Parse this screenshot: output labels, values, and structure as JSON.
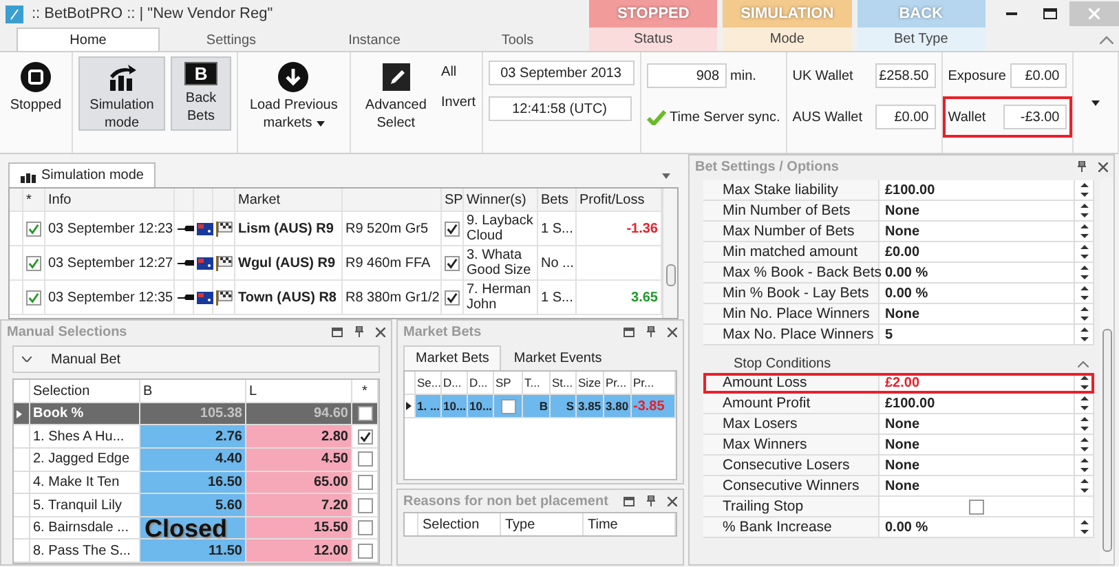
{
  "window": {
    "title": ":: BetBotPRO :: | \"New Vendor Reg\""
  },
  "ribbon_tabs": [
    {
      "label": "Home",
      "selected": true
    },
    {
      "label": "Settings",
      "selected": false
    },
    {
      "label": "Instance",
      "selected": false
    },
    {
      "label": "Tools",
      "selected": false
    }
  ],
  "context_tabs": [
    {
      "badge": "STOPPED",
      "label": "Status",
      "color": "#f29b9b"
    },
    {
      "badge": "SIMULATION",
      "label": "Mode",
      "color": "#f3c98c"
    },
    {
      "badge": "BACK",
      "label": "Bet Type",
      "color": "#b5d6ee"
    }
  ],
  "ribbon": {
    "buttons": [
      {
        "kind": "stop",
        "label": "Stopped",
        "selected": false,
        "dropdown": false
      },
      {
        "kind": "chart",
        "label": "Simulation mode",
        "selected": true,
        "dropdown": false
      },
      {
        "kind": "letter",
        "icon_text": "B",
        "label": "Back Bets",
        "selected": true,
        "dropdown": false
      },
      {
        "kind": "download",
        "label": "Load Previous markets",
        "selected": false,
        "dropdown": true
      },
      {
        "kind": "edit",
        "label": "Advanced Select",
        "selected": false,
        "dropdown": false
      }
    ],
    "select_links": [
      "All",
      "Invert"
    ],
    "date": "03 September 2013",
    "time": "12:41:58 (UTC)",
    "minutes": "908",
    "minutes_unit": "min.",
    "sync_label": "Time Server sync.",
    "wallets": [
      {
        "label": "UK Wallet",
        "value": "£258.50"
      },
      {
        "label": "AUS Wallet",
        "value": "£0.00"
      }
    ],
    "exposure": {
      "label": "Exposure",
      "value": "£0.00"
    },
    "wallet": {
      "label": "Wallet",
      "value": "-£3.00",
      "highlighted": true
    }
  },
  "simulation": {
    "tab": "Simulation mode",
    "columns": [
      "*",
      "Info",
      "Market",
      "SP",
      "Winner(s)",
      "Bets",
      "Profit/Loss"
    ],
    "rows": [
      {
        "checked": true,
        "info": "03 September 12:23",
        "market": "Lism (AUS) R9",
        "race": "R9 520m Gr5",
        "sp": true,
        "winner": "9. Layback Cloud",
        "bets": "1 S...",
        "pl": "-1.36",
        "color": "#e8202a"
      },
      {
        "checked": true,
        "info": "03 September 12:27",
        "market": "Wgul (AUS) R9",
        "race": "R9 460m FFA",
        "sp": true,
        "winner": "3. Whata Good Size",
        "bets": "No ..."
      },
      {
        "checked": true,
        "info": "03 September 12:35",
        "market": "Town (AUS) R8",
        "race": "R8 380m Gr1/2",
        "sp": true,
        "winner": "7. Herman John",
        "bets": "1 S...",
        "pl": "3.65",
        "color": "#1f9a2a"
      }
    ]
  },
  "manual": {
    "title": "Manual Selections",
    "section": "Manual Bet",
    "columns": [
      "Selection",
      "B",
      "L",
      "*"
    ],
    "book": {
      "label": "Book %",
      "back": "105.38",
      "lay": "94.60",
      "checked": false
    },
    "rows": [
      {
        "name": "1. Shes A Hu...",
        "back": "2.76",
        "lay": "2.80",
        "checked": true
      },
      {
        "name": "2. Jagged Edge",
        "back": "4.40",
        "lay": "4.50",
        "checked": false
      },
      {
        "name": "4. Make It Ten",
        "back": "16.50",
        "lay": "65.00",
        "checked": false
      },
      {
        "name": "5. Tranquil Lily",
        "back": "5.60",
        "lay": "7.20",
        "checked": false
      },
      {
        "name": "6. Bairnsdale ...",
        "lay": "15.50",
        "checked": false
      },
      {
        "name": "8. Pass The S...",
        "back": "11.50",
        "lay": "12.00",
        "checked": false
      }
    ],
    "overlay": "Closed"
  },
  "market_bets": {
    "title": "Market Bets",
    "tabs": [
      {
        "label": "Market Bets",
        "selected": true
      },
      {
        "label": "Market Events",
        "selected": false
      }
    ],
    "columns": [
      "Se...",
      "D...",
      "D...",
      "SP",
      "T...",
      "St...",
      "Size",
      "Pr...",
      "Pr..."
    ],
    "rows": [
      {
        "selected": true,
        "selection": "1. ...",
        "date_1": "10...",
        "date_2": "10...",
        "sp": false,
        "type": "B",
        "status": "S",
        "size": "3.85",
        "price": "3.80",
        "pl": "-3.85",
        "color": "#e8202a"
      }
    ]
  },
  "reasons": {
    "title": "Reasons for non bet placement",
    "columns": [
      "Selection",
      "Type",
      "Time"
    ]
  },
  "settings": {
    "title": "Bet Settings / Options",
    "rows": [
      {
        "label": "Max Stake liability",
        "value": "£100.00",
        "kind": "spin"
      },
      {
        "label": "Min Number of Bets",
        "value": "None",
        "kind": "spin"
      },
      {
        "label": "Max Number of Bets",
        "value": "None",
        "kind": "spin"
      },
      {
        "label": "Min matched amount",
        "value": "£0.00",
        "kind": "spin"
      },
      {
        "label": "Max % Book - Back Bets",
        "value": "0.00 %",
        "kind": "spin"
      },
      {
        "label": "Min % Book - Lay Bets",
        "value": "0.00 %",
        "kind": "spin"
      },
      {
        "label": "Min No. Place Winners",
        "value": "None",
        "kind": "spin"
      },
      {
        "label": "Max No. Place Winners",
        "value": "5",
        "kind": "spin"
      }
    ],
    "groups": [
      {
        "title": "Stop Conditions",
        "expanded": true,
        "rows": [
          {
            "label": "Amount Loss",
            "value": "£2.00",
            "kind": "spin",
            "highlighted": true
          },
          {
            "label": "Amount Profit",
            "value": "£100.00",
            "kind": "spin",
            "highlighted": false
          },
          {
            "label": "Max Losers",
            "value": "None",
            "kind": "spin",
            "highlighted": false
          },
          {
            "label": "Max Winners",
            "value": "None",
            "kind": "spin",
            "highlighted": false
          },
          {
            "label": "Consecutive Losers",
            "value": "None",
            "kind": "spin",
            "highlighted": false
          },
          {
            "label": "Consecutive Winners",
            "value": "None",
            "kind": "spin",
            "highlighted": false
          },
          {
            "label": "Trailing Stop",
            "kind": "checkbox",
            "checked": false,
            "highlighted": false
          },
          {
            "label": "% Bank Increase",
            "value": "0.00 %",
            "kind": "spin",
            "highlighted": false
          }
        ]
      }
    ]
  }
}
